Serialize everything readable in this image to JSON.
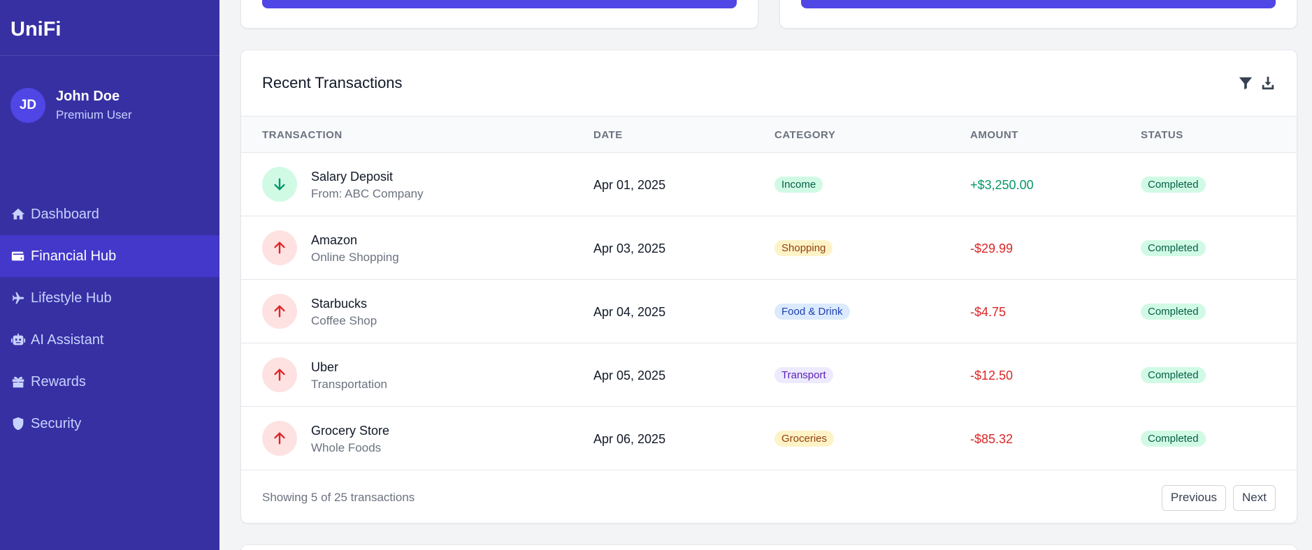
{
  "app": {
    "logo": "UniFi"
  },
  "user": {
    "initials": "JD",
    "name": "John Doe",
    "role": "Premium User"
  },
  "nav": {
    "items": [
      {
        "label": "Dashboard",
        "icon": "home-icon"
      },
      {
        "label": "Financial Hub",
        "icon": "wallet-icon",
        "active": true
      },
      {
        "label": "Lifestyle Hub",
        "icon": "plane-icon"
      },
      {
        "label": "AI Assistant",
        "icon": "robot-icon"
      },
      {
        "label": "Rewards",
        "icon": "gift-icon"
      },
      {
        "label": "Security",
        "icon": "shield-icon"
      }
    ]
  },
  "transactions": {
    "title": "Recent Transactions",
    "actions": [
      "filter-icon",
      "download-icon"
    ],
    "columns": [
      "TRANSACTION",
      "DATE",
      "CATEGORY",
      "AMOUNT",
      "STATUS"
    ],
    "rows": [
      {
        "name": "Salary Deposit",
        "sub": "From: ABC Company",
        "date": "Apr 01, 2025",
        "category": "Income",
        "amount": "+$3,250.00",
        "status": "Completed",
        "direction": "in"
      },
      {
        "name": "Amazon",
        "sub": "Online Shopping",
        "date": "Apr 03, 2025",
        "category": "Shopping",
        "amount": "-$29.99",
        "status": "Completed",
        "direction": "out"
      },
      {
        "name": "Starbucks",
        "sub": "Coffee Shop",
        "date": "Apr 04, 2025",
        "category": "Food & Drink",
        "amount": "-$4.75",
        "status": "Completed",
        "direction": "out"
      },
      {
        "name": "Uber",
        "sub": "Transportation",
        "date": "Apr 05, 2025",
        "category": "Transport",
        "amount": "-$12.50",
        "status": "Completed",
        "direction": "out"
      },
      {
        "name": "Grocery Store",
        "sub": "Whole Foods",
        "date": "Apr 06, 2025",
        "category": "Groceries",
        "amount": "-$85.32",
        "status": "Completed",
        "direction": "out"
      }
    ],
    "footer_text": "Showing 5 of 25 transactions",
    "prev_label": "Previous",
    "next_label": "Next"
  },
  "colors": {
    "sidebar": "#3730a3",
    "sidebar_active": "#4338ca",
    "accent": "#4f46e5",
    "positive": "#059669",
    "negative": "#dc2626"
  }
}
